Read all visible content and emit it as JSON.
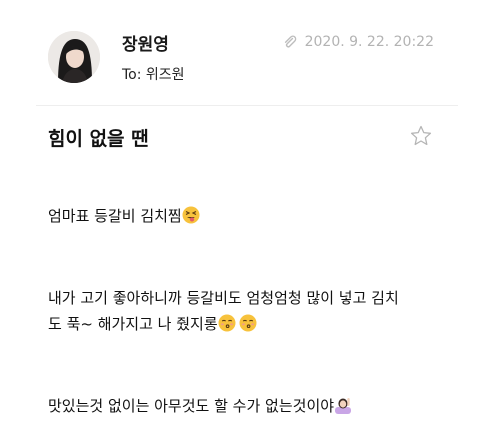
{
  "sender": {
    "name": "장원영"
  },
  "recipient": {
    "to": "To: 위즈원"
  },
  "meta": {
    "date": "2020. 9. 22. 20:22",
    "attachment_icon": "paperclip-icon"
  },
  "subject": {
    "title": "힘이 없을 땐",
    "favorite_icon": "star-outline-icon"
  },
  "body": {
    "p1": "엄마표 등갈비 김치찜",
    "p2_line1": "내가 고기 좋아하니까 등갈비도 엄청엄청 많이 넣고 김치",
    "p2_line2": "도 푹~ 해가지고 나 줬지롱",
    "p3": "맛있는것 없이는 아무것도 할 수가 없는것이야",
    "emojis": [
      "squinting-tongue-face-emoji",
      "kissing-face-emoji",
      "kissing-face-emoji",
      "person-raising-hand-emoji"
    ]
  },
  "colors": {
    "meta_gray": "#b3b3b3",
    "divider": "#eeeeee",
    "emoji_yellow": "#f7c23c"
  }
}
